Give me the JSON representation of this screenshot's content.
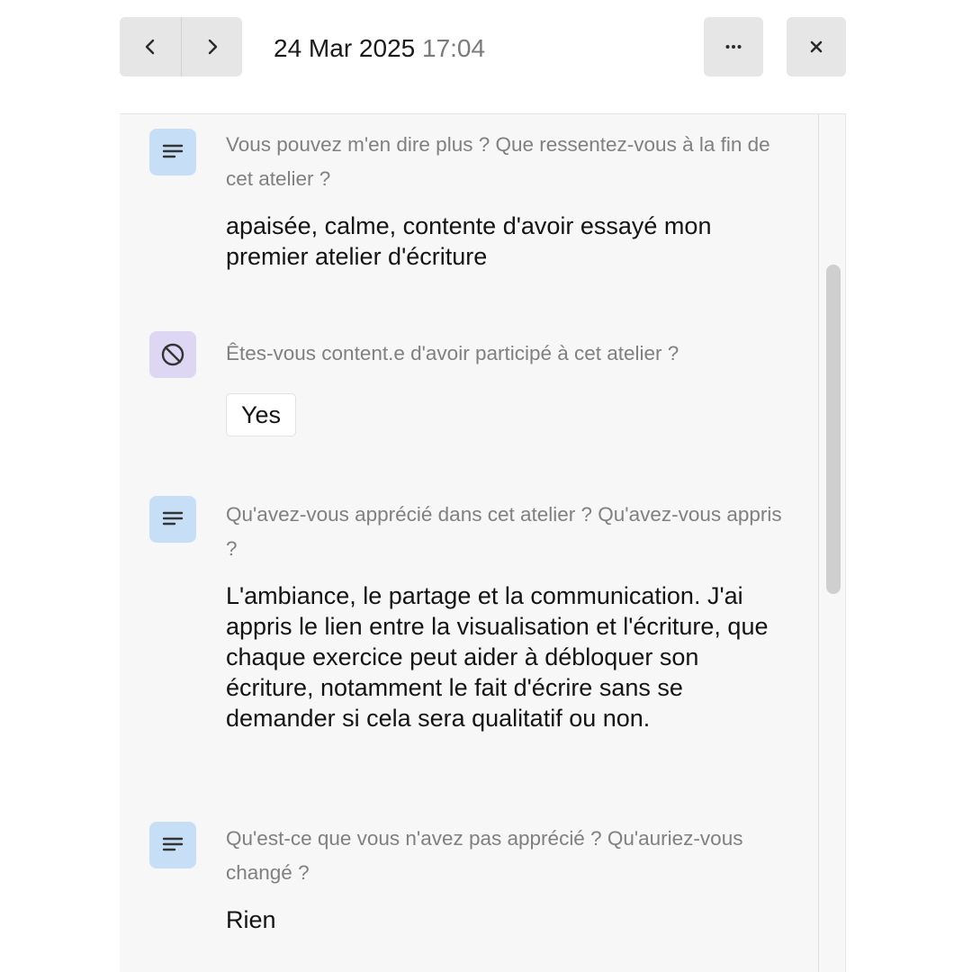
{
  "header": {
    "prev_icon": "chevron-left-icon",
    "next_icon": "chevron-right-icon",
    "date": "24 Mar 2025",
    "time": "17:04",
    "more_icon": "more-horizontal-icon",
    "close_icon": "close-icon"
  },
  "responses": [
    {
      "type": "text",
      "icon": "text-lines-icon",
      "question": "Vous pouvez m'en dire plus ? Que ressentez-vous à la fin de cet atelier ?",
      "answer": "apaisée, calme, contente d'avoir essayé mon premier atelier d'écriture"
    },
    {
      "type": "yes-no",
      "icon": "yes-no-icon",
      "question": "Êtes-vous content.e d'avoir participé à cet atelier ?",
      "answer": "Yes"
    },
    {
      "type": "text",
      "icon": "text-lines-icon",
      "question": "Qu'avez-vous apprécié dans cet atelier ? Qu'avez-vous appris ?",
      "answer": "L'ambiance, le partage et la communication. J'ai appris le lien entre la visualisation et l'écriture, que chaque exercice peut aider à débloquer son écriture, notamment le fait d'écrire sans se demander si cela sera qualitatif ou non."
    },
    {
      "type": "text",
      "icon": "text-lines-icon",
      "question": "Qu'est-ce que vous n'avez pas apprécié ? Qu'auriez-vous changé ?",
      "answer": "Rien"
    }
  ],
  "colors": {
    "text_icon_bg": "#c6dff7",
    "yesno_icon_bg": "#ddd7f3",
    "panel_bg": "#f7f7f7",
    "button_bg": "#e6e6e6"
  }
}
